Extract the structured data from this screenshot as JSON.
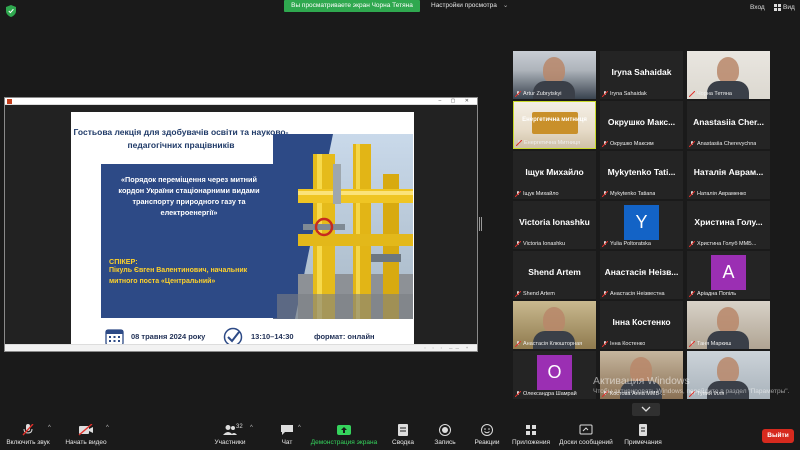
{
  "topbar": {
    "sharing_banner": "Вы просматриваете экран Чорна Тетяна",
    "view_settings": "Настройки просмотра",
    "enter_label": "Вход",
    "view_label": "Вид"
  },
  "slide": {
    "heading": "Гостьова лекція для здобувачів освіти та науково-педагогічних працівників",
    "card_title": "«Порядок переміщення через митний кордон України стаціонарними видами транспорту природного газу та електроенергії»",
    "speaker_label": "СПІКЕР:",
    "speaker_info": "Пікуль Євген Валентинович, начальник митного поста «Центральний»",
    "date": "08 травня 2024 року",
    "time": "13:10–14:30",
    "format": "формат: онлайн"
  },
  "participants": [
    {
      "caption": "Artur Zubrytskyi",
      "big": "",
      "type": "video"
    },
    {
      "caption": "Iryna Sahaidak",
      "big": "Iryna Sahaidak",
      "type": "name"
    },
    {
      "caption": "Чорна Тетяна",
      "big": "",
      "type": "video"
    },
    {
      "caption": "Енергетична Митниця",
      "big": "Енергетична митниця",
      "type": "video-logo"
    },
    {
      "caption": "Окрушко Максим",
      "big": "Окрушко Макс...",
      "type": "name"
    },
    {
      "caption": "Anastasiia Cherevychna",
      "big": "Anastasiia Cher...",
      "type": "name"
    },
    {
      "caption": "Іщук Михайло",
      "big": "Іщук Михайло",
      "type": "name"
    },
    {
      "caption": "Mykytenko Tatiana",
      "big": "Mykytenko Tati...",
      "type": "name"
    },
    {
      "caption": "Наталія Авраменко",
      "big": "Наталія Аврам...",
      "type": "name"
    },
    {
      "caption": "Victoria Ionashku",
      "big": "Victoria Ionashku",
      "type": "name"
    },
    {
      "caption": "Yulia Poltoratska",
      "big": "Y",
      "type": "avatar",
      "color": "#1363c6"
    },
    {
      "caption": "Христина Голуб ММБ...",
      "big": "Христина Голу...",
      "type": "name"
    },
    {
      "caption": "Shend Artem",
      "big": "Shend Artem",
      "type": "name"
    },
    {
      "caption": "Анастасія Неізвестна",
      "big": "Анастасія Неізв...",
      "type": "name"
    },
    {
      "caption": "Аріадна Попіль",
      "big": "A",
      "type": "avatar",
      "color": "#9b2fb3"
    },
    {
      "caption": "Анастасія Клюшторная",
      "big": "",
      "type": "video"
    },
    {
      "caption": "Інна Костенко",
      "big": "Інна Костенко",
      "type": "name"
    },
    {
      "caption": "Таня Маркиш",
      "big": "",
      "type": "video"
    },
    {
      "caption": "Олександра Шамрай",
      "big": "О",
      "type": "avatar",
      "color": "#9b2fb3"
    },
    {
      "caption": "Костова Анна ММБ-...",
      "big": "",
      "type": "video"
    },
    {
      "caption": "Тупий Ілля",
      "big": "",
      "type": "video"
    }
  ],
  "watermark": {
    "line1": "Активация Windows",
    "line2": "Чтобы активировать Windows, перейдите в раздел \"Параметры\"."
  },
  "toolbar": {
    "mute": "Включить звук",
    "video": "Начать видео",
    "participants": "Участники",
    "participants_count": "32",
    "chat": "Чат",
    "share": "Демонстрация экрана",
    "summary": "Сводка",
    "record": "Запись",
    "reactions": "Реакции",
    "apps": "Приложения",
    "whiteboard": "Доски сообщений",
    "notes": "Примечания",
    "leave": "Выйти"
  },
  "colors": {
    "share_green": "#2fa84f",
    "leave_red": "#d62a1e",
    "slide_blue": "#2d4a86",
    "speaker_yellow": "#ffd22a",
    "active_border": "#c8d92a"
  }
}
